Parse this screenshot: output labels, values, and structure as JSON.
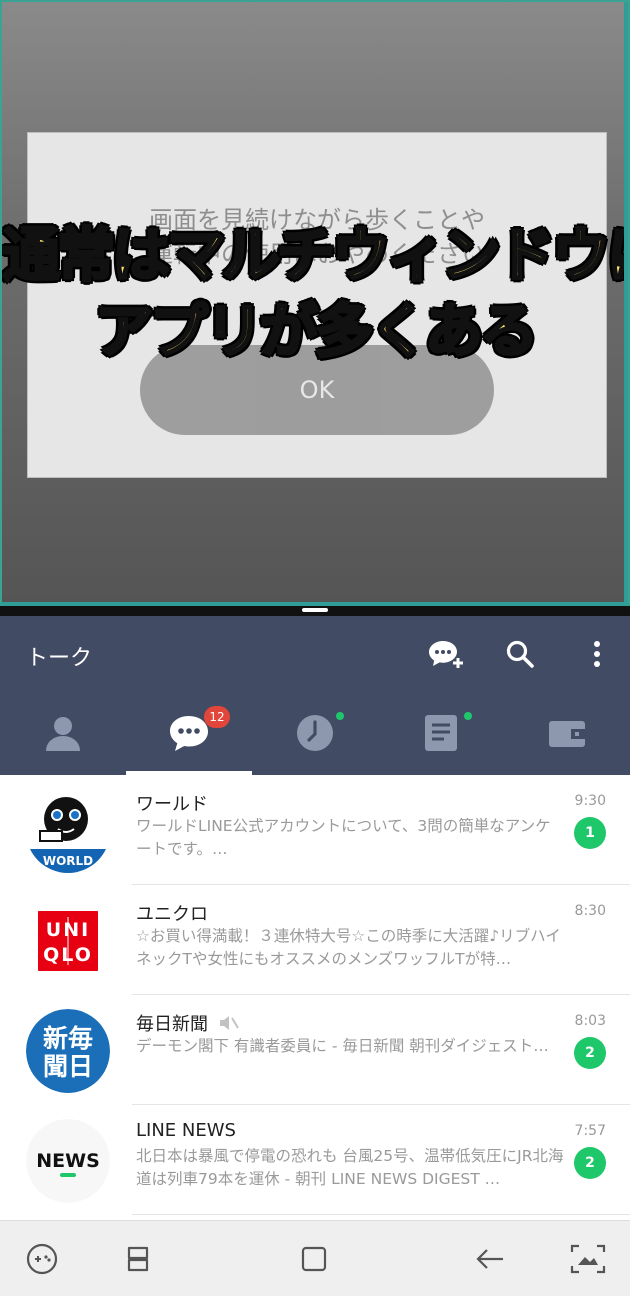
{
  "top_window": {
    "dialog_text_line1": "画面を見続けながら歩くことや",
    "dialog_text_line2": "運転中の使用はおやめください",
    "dialog_button_label": "OK",
    "caption_line1": "通常はマルチウィンドウに出来ない",
    "caption_line2": "アプリが多くある"
  },
  "header": {
    "title": "トーク",
    "icons": [
      "add-chat-icon",
      "search-icon",
      "more-vertical-icon"
    ]
  },
  "tabs": [
    {
      "name": "friends",
      "icon": "person-icon"
    },
    {
      "name": "chats",
      "icon": "chat-bubble-icon",
      "badge": "12",
      "active": true
    },
    {
      "name": "timeline",
      "icon": "clock-icon",
      "dot": true
    },
    {
      "name": "news",
      "icon": "document-icon",
      "dot": true
    },
    {
      "name": "wallet",
      "icon": "wallet-icon"
    }
  ],
  "chats": [
    {
      "name": "ワールド",
      "time": "9:30",
      "message": "ワールドLINE公式アカウントについて、3問の簡単なアンケートです。…",
      "count": "1",
      "avatar_label": "WORLD"
    },
    {
      "name": "ユニクロ",
      "time": "8:30",
      "message": "☆お買い得満載！３連休特大号☆この時季に大活躍♪リブハイネックTや女性にもオススメのメンズワッフルTが特…",
      "count": "",
      "avatar_label": "UNIQLO"
    },
    {
      "name": "毎日新聞",
      "time": "8:03",
      "message": "デーモン閣下 有識者委員に - 毎日新聞 朝刊ダイジェスト…",
      "count": "2",
      "avatar_label": "新毎聞日",
      "muted": true
    },
    {
      "name": "LINE NEWS",
      "time": "7:57",
      "message": "北日本は暴風で停電の恐れも 台風25号、温帯低気圧にJR北海道は列車79本を運休 - 朝刊 LINE NEWS DIGEST …",
      "count": "2",
      "avatar_label": "NEWS"
    }
  ],
  "colors": {
    "header": "#414b63",
    "badge_red": "#e2453a",
    "unread_green": "#1ec86a",
    "split_border": "#2e9e97"
  },
  "navbar": [
    "game-icon",
    "recent-apps-icon",
    "home-icon",
    "back-icon",
    "screenshot-icon"
  ]
}
